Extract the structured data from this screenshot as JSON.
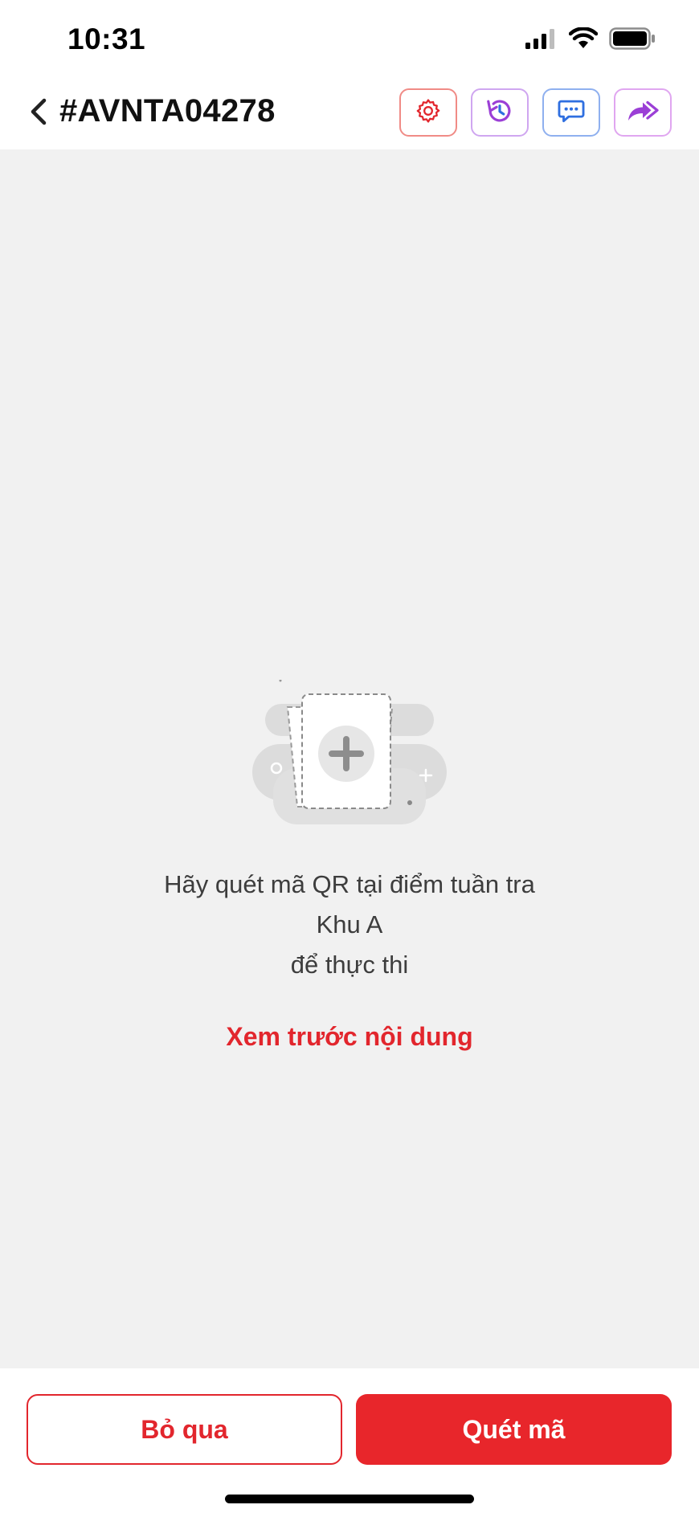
{
  "status_bar": {
    "time": "10:31",
    "icons": [
      "signal-icon",
      "wifi-icon",
      "battery-icon"
    ]
  },
  "header": {
    "back_icon": "chevron-left-icon",
    "title": "#AVNTA04278",
    "actions": [
      {
        "name": "settings-button",
        "icon": "gear-icon",
        "color": "#e2262d"
      },
      {
        "name": "history-button",
        "icon": "history-icon",
        "color": "#9b3fd6"
      },
      {
        "name": "chat-button",
        "icon": "chat-icon",
        "color": "#2f6fe0"
      },
      {
        "name": "forward-button",
        "icon": "forward-icon",
        "color": "#9b3fd6"
      }
    ]
  },
  "main": {
    "empty_icon": "add-document-icon",
    "message_line1": "Hãy quét mã QR tại điểm tuần tra",
    "message_line2": "Khu A",
    "message_line3": "để thực thi",
    "preview_link": "Xem trước nội dung"
  },
  "footer": {
    "skip_label": "Bỏ qua",
    "scan_label": "Quét mã"
  },
  "colors": {
    "accent": "#e2262d",
    "background": "#f1f1f1"
  }
}
